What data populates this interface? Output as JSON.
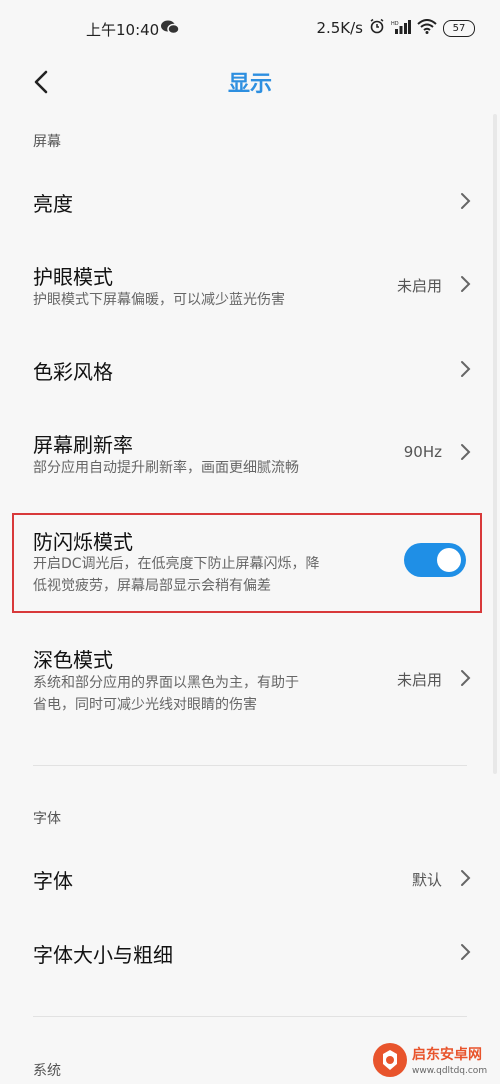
{
  "status_bar": {
    "time": "上午10:40",
    "net_speed": "2.5K/s",
    "battery": "57",
    "icons": [
      "wechat-icon",
      "alarm-icon",
      "signal-icon",
      "wifi-icon",
      "battery-icon"
    ]
  },
  "header": {
    "title": "显示"
  },
  "sections": {
    "screen": "屏幕",
    "font": "字体",
    "system": "系统"
  },
  "rows": {
    "brightness": {
      "title": "亮度"
    },
    "eye_mode": {
      "title": "护眼模式",
      "subtitle": "护眼模式下屏幕偏暖，可以减少蓝光伤害",
      "value": "未启用"
    },
    "color_style": {
      "title": "色彩风格"
    },
    "refresh_rate": {
      "title": "屏幕刷新率",
      "subtitle": "部分应用自动提升刷新率，画面更细腻流畅",
      "value": "90Hz"
    },
    "anti_flicker": {
      "title": "防闪烁模式",
      "subtitle_line1": "开启DC调光后，在低亮度下防止屏幕闪烁，降",
      "subtitle_line2": "低视觉疲劳，屏幕局部显示会稍有偏差",
      "enabled": true
    },
    "dark_mode": {
      "title": "深色模式",
      "subtitle_line1": "系统和部分应用的界面以黑色为主，有助于",
      "subtitle_line2": "省电，同时可减少光线对眼睛的伤害",
      "value": "未启用"
    },
    "font": {
      "title": "字体",
      "value": "默认"
    },
    "font_size": {
      "title": "字体大小与粗细"
    }
  },
  "watermark": {
    "line1": "启东安卓网",
    "line2": "www.qdltdq.com"
  },
  "colors": {
    "accent": "#2d8fe0",
    "toggle_on": "#1f8fe6",
    "highlight": "#d8393a"
  }
}
